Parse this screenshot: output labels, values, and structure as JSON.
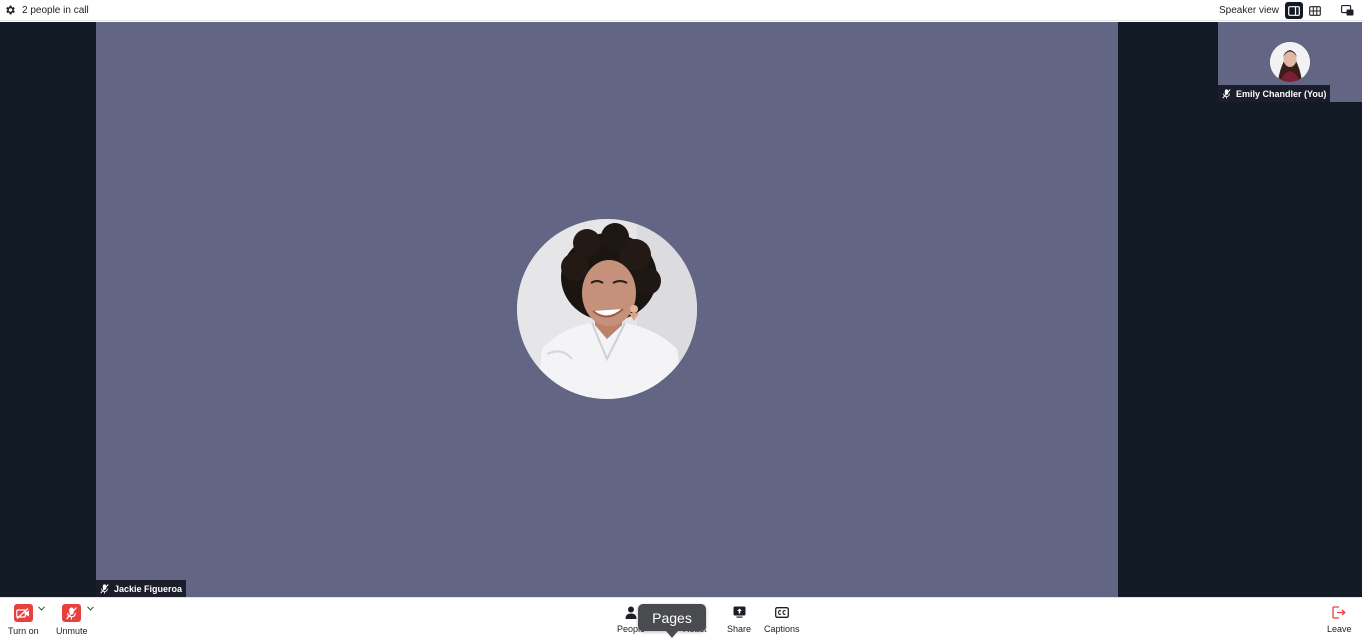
{
  "topbar": {
    "settings_icon": "gear-icon",
    "title": "2 people in call",
    "view_label": "Speaker view",
    "speaker_view_icon": "speaker-view-icon",
    "grid_view_icon": "grid-view-icon",
    "popout_icon": "picture-in-picture-icon"
  },
  "main_participant": {
    "name": "Jackie Figueroa",
    "mic_status_icon": "mic-off-icon"
  },
  "self_participant": {
    "name": "Emily Chandler (You)",
    "mic_status_icon": "mic-off-icon"
  },
  "toolbar": {
    "camera_label": "Turn on",
    "mic_label": "Unmute",
    "people_label": "People",
    "react_label": "React",
    "share_label": "Share",
    "captions_label": "Captions",
    "leave_label": "Leave"
  },
  "tooltip": {
    "text": "Pages"
  },
  "colors": {
    "stage_bg": "#121a26",
    "tile_bg": "#626583",
    "danger": "#e8413d"
  }
}
